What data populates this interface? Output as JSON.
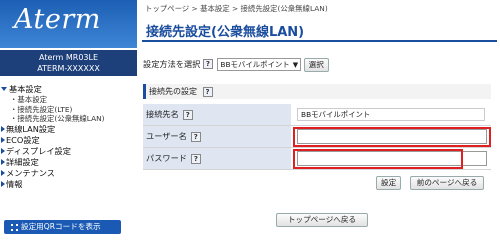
{
  "sidebar": {
    "logo": "Aterm",
    "model_line1": "Aterm MR03LE",
    "model_line2": "ATERM-XXXXXX",
    "menu": [
      {
        "label": "基本設定",
        "expanded": true,
        "children": [
          "基本設定",
          "接続先設定(LTE)",
          "接続先設定(公衆無線LAN)"
        ]
      },
      {
        "label": "無線LAN設定"
      },
      {
        "label": "ECO設定"
      },
      {
        "label": "ディスプレイ設定"
      },
      {
        "label": "詳細設定"
      },
      {
        "label": "メンテナンス"
      },
      {
        "label": "情報"
      }
    ],
    "qr_button": "設定用QRコードを表示"
  },
  "breadcrumb": "トップページ > 基本設定 > 接続先設定(公衆無線LAN)",
  "page_title": "接続先設定(公衆無線LAN)",
  "method": {
    "label": "設定方法を選択",
    "help": "?",
    "selected": "BBモバイルポイント",
    "select_button": "選択"
  },
  "section": {
    "title": "接続先の設定",
    "help": "?"
  },
  "form": {
    "name_label": "接続先名",
    "name_value": "BBモバイルポイント",
    "user_label": "ユーザー名",
    "user_value": "",
    "password_label": "パスワード",
    "password_value": "",
    "help": "?"
  },
  "buttons": {
    "set": "設定",
    "back": "前のページへ戻る",
    "top": "トップページへ戻る"
  },
  "colors": {
    "brand_blue": "#1a4d9e",
    "highlight_red": "#e02020"
  }
}
